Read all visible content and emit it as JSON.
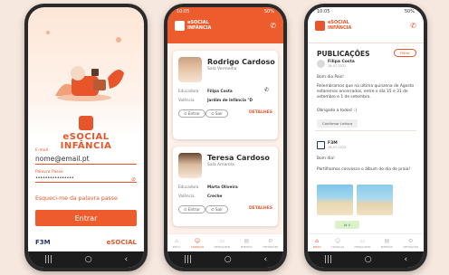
{
  "colors": {
    "accent": "#e8552a",
    "background": "#f7e8df",
    "navy": "#23346e"
  },
  "login": {
    "logo_line1": "eSOCIAL",
    "logo_line2": "INFÂNCIA",
    "email_label": "E-mail",
    "email_value": "nome@email.pt",
    "password_label": "Palavra Passe",
    "password_value": "••••••••••••••••",
    "forgot_label": "Esqueci-me da palavra passe",
    "enter_label": "Entrar",
    "brand_left": "F3M",
    "brand_right": "eSOCIAL"
  },
  "children": {
    "status_time": "10:05",
    "status_battery": "50%",
    "header_line1": "eSOCIAL",
    "header_line2": "INFÂNCIA",
    "cards": [
      {
        "name": "Rodrigo Cardoso",
        "room": "Sala Vermelha",
        "educator_label": "Educadora",
        "educator_value": "Filipa Costa",
        "valence_label": "Valência",
        "valence_value": "Jardim de Infância \"D",
        "enter_label": "Entrar",
        "exit_label": "Sair",
        "details_label": "DETALHES"
      },
      {
        "name": "Teresa Cardoso",
        "room": "Sala Amarela",
        "educator_label": "Educadora",
        "educator_value": "Marta Oliveira",
        "valence_label": "Valência",
        "valence_value": "Creche",
        "enter_label": "Entrar",
        "exit_label": "Sair",
        "details_label": "DETALHES"
      }
    ],
    "tabs": [
      {
        "label": "INÍCIO",
        "icon": "home-icon"
      },
      {
        "label": "CRIANÇAS",
        "icon": "children-icon"
      },
      {
        "label": "MENSAGENS",
        "icon": "messages-icon"
      },
      {
        "label": "EMENTAS",
        "icon": "menu-icon"
      },
      {
        "label": "DEFINIÇÕES",
        "icon": "settings-icon"
      }
    ]
  },
  "feed": {
    "status_time": "10:05",
    "status_battery": "50%",
    "header_line1": "eSOCIAL",
    "header_line2": "INFÂNCIA",
    "title": "PUBLICAÇÕES",
    "filter_label": "Filtrar",
    "posts": [
      {
        "author": "Filipa Costa",
        "date": "28-07-2022",
        "greeting": "Bom dia Pais!",
        "body": "Relembramos que na última quinzena de Agosto estaremos encerrados, entre o dia 15 e 31 de setembro e 1 de setembro.",
        "thanks": "Obrigado a todos! :)",
        "action": "Confirmar Leitura"
      },
      {
        "author": "F3M",
        "date": "28-07-2022",
        "greeting": "Bom dia!",
        "body": "Partilhamos convosco o álbum do dia de praia!",
        "action": "Já li"
      }
    ],
    "tabs": [
      {
        "label": "INÍCIO",
        "icon": "home-icon"
      },
      {
        "label": "CRIANÇAS",
        "icon": "children-icon"
      },
      {
        "label": "MENSAGENS",
        "icon": "messages-icon"
      },
      {
        "label": "EMENTAS",
        "icon": "menu-icon"
      },
      {
        "label": "DEFINIÇÕES",
        "icon": "settings-icon"
      }
    ]
  }
}
